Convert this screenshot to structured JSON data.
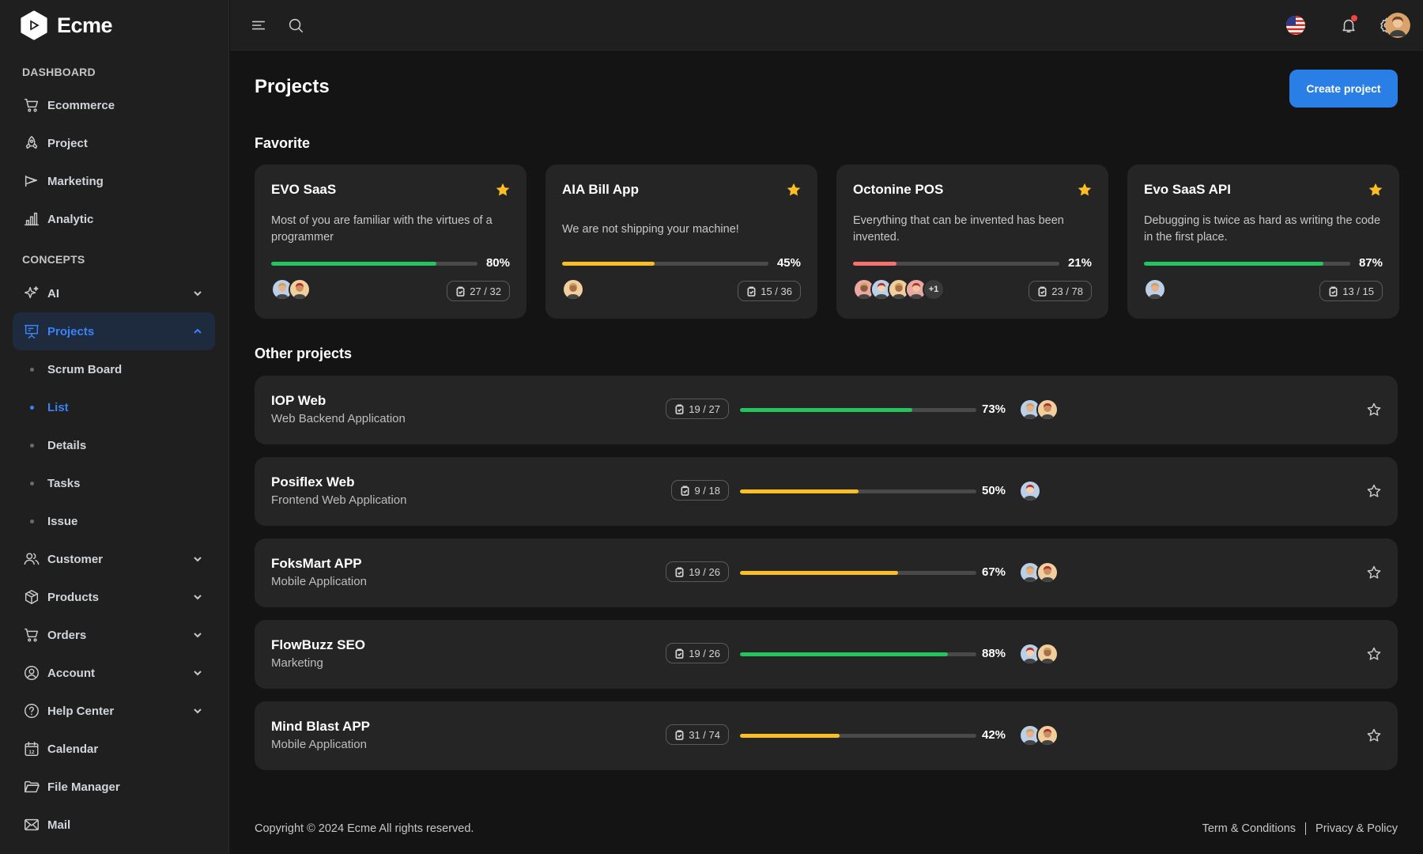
{
  "app": {
    "name": "Ecme"
  },
  "sidebar": {
    "sections": [
      {
        "label": "DASHBOARD"
      },
      {
        "label": "CONCEPTS"
      }
    ],
    "dashboard_items": [
      {
        "label": "Ecommerce",
        "icon": "cart-icon"
      },
      {
        "label": "Project",
        "icon": "rocket-icon"
      },
      {
        "label": "Marketing",
        "icon": "megaphone-icon"
      },
      {
        "label": "Analytic",
        "icon": "bar-chart-icon"
      }
    ],
    "concept_items": [
      {
        "label": "AI",
        "icon": "sparkle-icon",
        "expandable": true
      },
      {
        "label": "Projects",
        "icon": "presentation-icon",
        "expandable": true,
        "active": true
      }
    ],
    "project_sub_items": [
      {
        "label": "Scrum Board"
      },
      {
        "label": "List",
        "active": true
      },
      {
        "label": "Details"
      },
      {
        "label": "Tasks"
      },
      {
        "label": "Issue"
      }
    ],
    "more_items": [
      {
        "label": "Customer",
        "icon": "users-icon",
        "expandable": true
      },
      {
        "label": "Products",
        "icon": "box-icon",
        "expandable": true
      },
      {
        "label": "Orders",
        "icon": "cart-icon",
        "expandable": true
      },
      {
        "label": "Account",
        "icon": "user-circle-icon",
        "expandable": true
      },
      {
        "label": "Help Center",
        "icon": "help-icon",
        "expandable": true
      },
      {
        "label": "Calendar",
        "icon": "calendar-icon",
        "calendar_day": "12"
      },
      {
        "label": "File Manager",
        "icon": "folder-icon"
      },
      {
        "label": "Mail",
        "icon": "mail-icon"
      }
    ]
  },
  "topbar": {
    "icons": [
      "menu-icon",
      "search-icon",
      "us-flag-icon",
      "bell-icon",
      "gear-icon",
      "user-avatar"
    ]
  },
  "page": {
    "title": "Projects",
    "create_button": "Create project",
    "favorite_title": "Favorite",
    "other_title": "Other projects"
  },
  "favorites": [
    {
      "name": "EVO SaaS",
      "description": "Most of you are familiar with the virtues of a programmer",
      "progress": 80,
      "progress_label": "80%",
      "tasks": "27 / 32",
      "color": "#22c55e",
      "members": 2,
      "extra_members": ""
    },
    {
      "name": "AIA Bill App",
      "description": "We are not shipping your machine!",
      "progress": 45,
      "progress_label": "45%",
      "tasks": "15 / 36",
      "color": "#fbbf24",
      "members": 1,
      "extra_members": ""
    },
    {
      "name": "Octonine POS",
      "description": "Everything that can be invented has been invented.",
      "progress": 21,
      "progress_label": "21%",
      "tasks": "23 / 78",
      "color": "#f87171",
      "members": 4,
      "extra_members": "+1"
    },
    {
      "name": "Evo SaaS API",
      "description": "Debugging is twice as hard as writing the code in the first place.",
      "progress": 87,
      "progress_label": "87%",
      "tasks": "13 / 15",
      "color": "#22c55e",
      "members": 1,
      "extra_members": ""
    }
  ],
  "projects": [
    {
      "name": "IOP Web",
      "category": "Web Backend Application",
      "tasks": "19 / 27",
      "progress": 73,
      "progress_label": "73%",
      "color": "#22c55e",
      "members": 2
    },
    {
      "name": "Posiflex Web",
      "category": "Frontend Web Application",
      "tasks": "9 / 18",
      "progress": 50,
      "progress_label": "50%",
      "color": "#fbbf24",
      "members": 1
    },
    {
      "name": "FoksMart APP",
      "category": "Mobile Application",
      "tasks": "19 / 26",
      "progress": 67,
      "progress_label": "67%",
      "color": "#fbbf24",
      "members": 2
    },
    {
      "name": "FlowBuzz SEO",
      "category": "Marketing",
      "tasks": "19 / 26",
      "progress": 88,
      "progress_label": "88%",
      "color": "#22c55e",
      "members": 2
    },
    {
      "name": "Mind Blast APP",
      "category": "Mobile Application",
      "tasks": "31 / 74",
      "progress": 42,
      "progress_label": "42%",
      "color": "#fbbf24",
      "members": 2
    }
  ],
  "footer": {
    "copyright": "Copyright © 2024 Ecme All rights reserved.",
    "terms": "Term & Conditions",
    "privacy": "Privacy & Policy"
  },
  "colors": {
    "accent": "#2a7fe6",
    "star": "#fbbf24",
    "success": "#22c55e",
    "warning": "#fbbf24",
    "danger": "#f87171"
  }
}
